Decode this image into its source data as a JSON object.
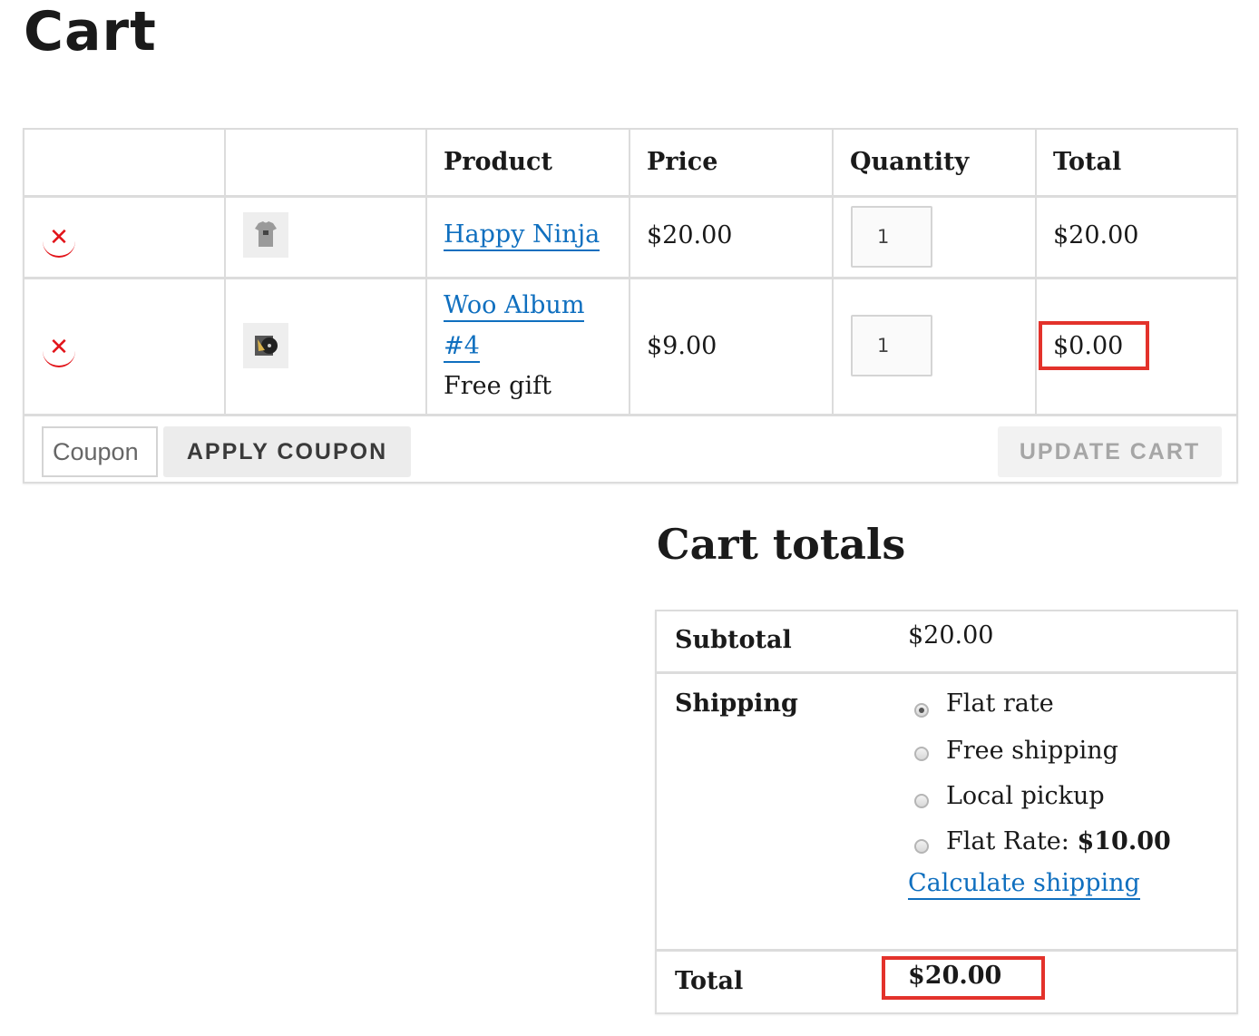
{
  "page_title": "Cart",
  "cart": {
    "headers": [
      "",
      "",
      "Product",
      "Price",
      "Quantity",
      "Total"
    ],
    "rows": [
      {
        "remove_icon": "close-icon",
        "thumb": "tshirt-thumbnail",
        "product_name": "Happy Ninja",
        "price": "$20.00",
        "quantity": "1",
        "total": "$20.00"
      },
      {
        "remove_icon": "close-icon",
        "thumb": "album-thumbnail",
        "product_name_line1": "Woo Album",
        "product_name_line2": "#4",
        "note": "Free gift",
        "price": "$9.00",
        "quantity": "1",
        "total": "$0.00"
      }
    ],
    "coupon_placeholder": "Coupon",
    "apply_coupon_label": "APPLY COUPON",
    "update_cart_label": "UPDATE CART"
  },
  "totals": {
    "title": "Cart totals",
    "subtotal_label": "Subtotal",
    "subtotal_value": "$20.00",
    "shipping_label": "Shipping",
    "shipping_options": [
      {
        "label": "Flat rate",
        "selected": true
      },
      {
        "label": "Free shipping",
        "selected": false
      },
      {
        "label": "Local pickup",
        "selected": false
      },
      {
        "label": "Flat Rate:",
        "price": "$10.00",
        "selected": false
      }
    ],
    "calculate_shipping": "Calculate shipping",
    "total_label": "Total",
    "total_value": "$20.00"
  },
  "colors": {
    "link": "#0f6fbf",
    "remove": "#e2141a",
    "highlight": "#e3322b",
    "border": "#dcdcdc"
  }
}
